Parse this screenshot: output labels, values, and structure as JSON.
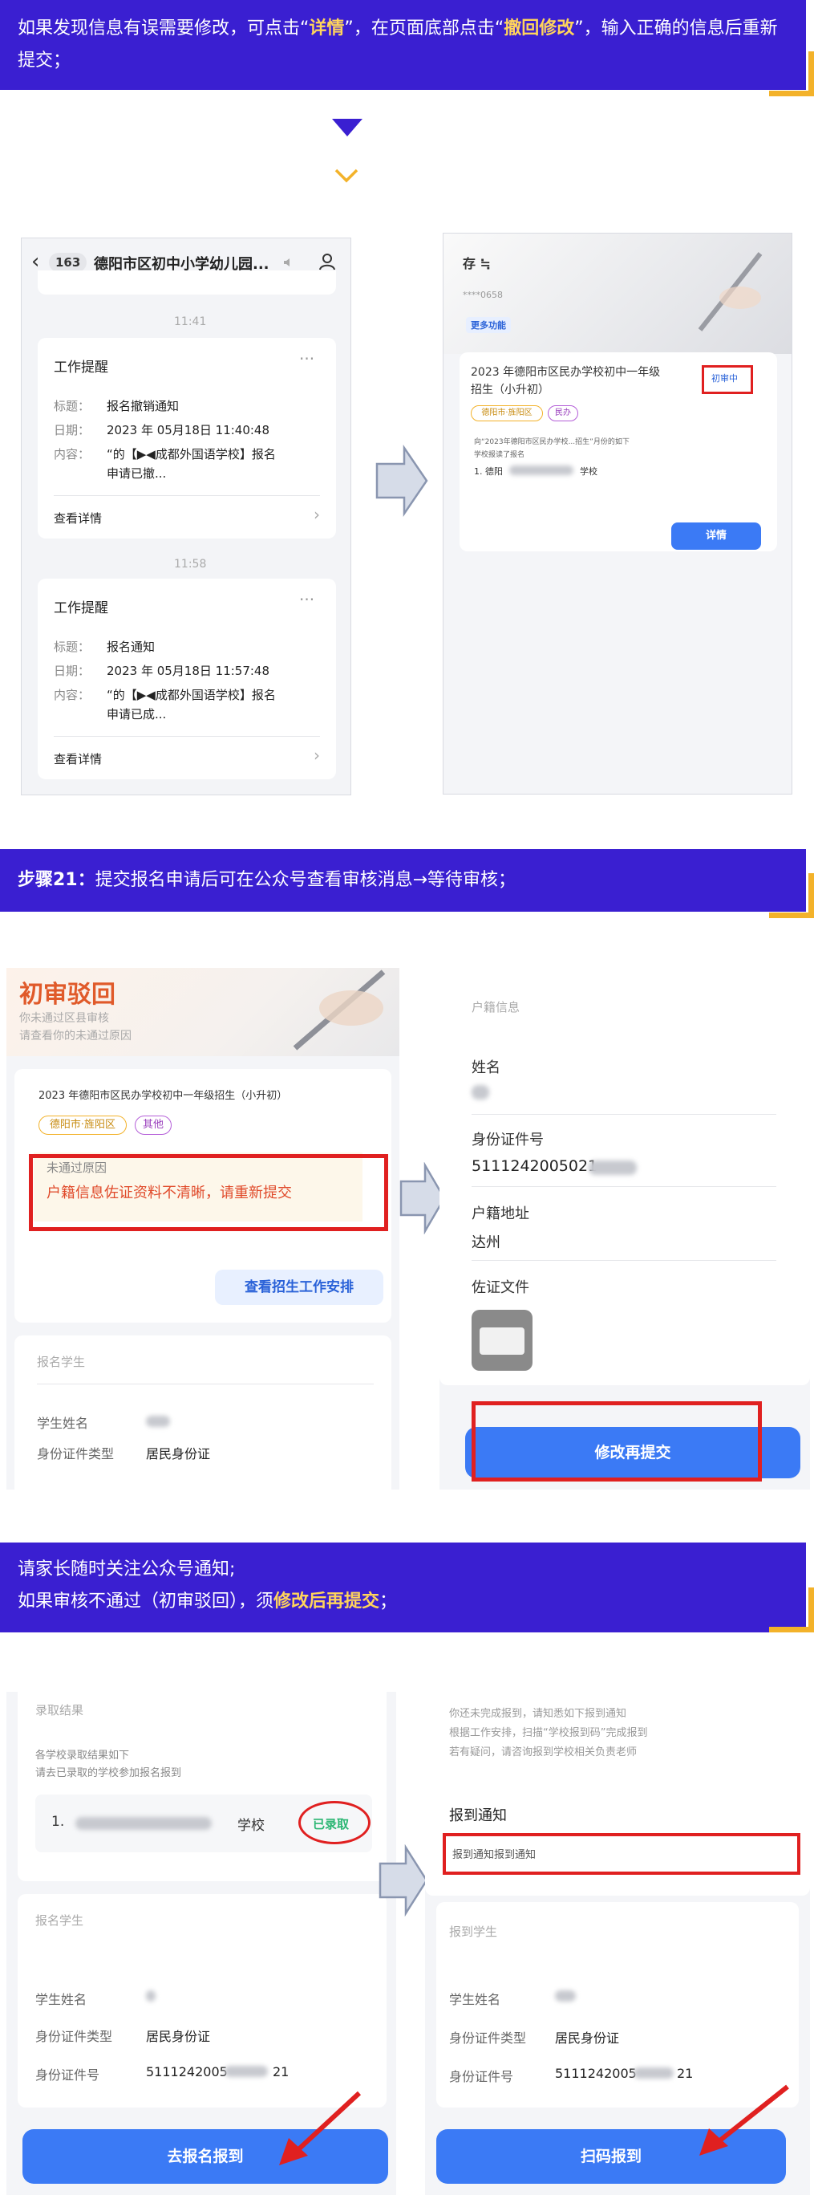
{
  "banner1": {
    "pre": "如果发现信息有误需要修改，可点击“",
    "detail": "详情",
    "mid": "”，在页面底部点击“",
    "withdraw": "撤回修改",
    "post": "”，输入正确的信息后重新提交；"
  },
  "banner2": {
    "step": "步骤21：",
    "text": "提交报名申请后可在公众号查看审核消息→等待审核；"
  },
  "banner3": {
    "line1": "请家长随时关注公众号通知;",
    "line2_pre": "如果审核不通过（初审驳回），须",
    "line2_bold": "修改后再提交",
    "line2_post": "；"
  },
  "phone1": {
    "badge": "163",
    "title": "德阳市区初中小学幼儿园...",
    "time1": "11:41",
    "time2": "11:58",
    "card1": {
      "head": "工作提醒",
      "l1": "标题：",
      "v1": "报名撤销通知",
      "l2": "日期：",
      "v2": "2023 年 05月18日 11:40:48",
      "l3": "内容：",
      "v3a": "“的【▶◀成都外国语学校】报名",
      "v3b": "申请已撤...",
      "link": "查看详情"
    },
    "card2": {
      "head": "工作提醒",
      "l1": "标题：",
      "v1": "报名通知",
      "l2": "日期：",
      "v2": "2023 年 05月18日 11:57:48",
      "l3": "内容：",
      "v3a": "“的【▶◀成都外国语学校】报名",
      "v3b": "申请已成...",
      "link": "查看详情"
    }
  },
  "phone2": {
    "top": "存 ≒",
    "masked": "****0658",
    "more": "更多功能",
    "app_title1": "2023 年德阳市区民办学校初中一年级",
    "app_title2": "招生（小升初）",
    "status": "初审中",
    "tag1": "德阳市·旌阳区",
    "tag2": "民办",
    "desc1": "向“2023年德阳市区民办学校...招生”月份的如下",
    "desc2": "学校报读了报名",
    "school": "1. 德阳",
    "school_end": "学校",
    "detail_btn": "详情"
  },
  "shot3": {
    "head": "初审驳回",
    "sub1": "你未通过区县审核",
    "sub2": "请查看你的未通过原因",
    "app_title": "2023 年德阳市区民办学校初中一年级招生（小升初）",
    "tag1": "德阳市·旌阳区",
    "tag2": "其他",
    "reason_label": "未通过原因",
    "reason": "户籍信息佐证资料不清晰，请重新提交",
    "arrange_btn": "查看招生工作安排",
    "student_head": "报名学生",
    "name_label": "学生姓名",
    "id_type_label": "身份证件类型",
    "id_type": "居民身份证"
  },
  "shot4": {
    "section": "户籍信息",
    "name_label": "姓名",
    "id_label": "身份证件号",
    "id_value": "5111242005021",
    "addr_label": "户籍地址",
    "addr_value": "达州",
    "proof_label": "佐证文件",
    "resubmit_btn": "修改再提交"
  },
  "shot5": {
    "head": "录取结果",
    "desc1": "各学校录取结果如下",
    "desc2": "请去已录取的学校参加报名报到",
    "school_prefix": "1.",
    "school_suffix": "学校",
    "admitted": "已录取",
    "student_head": "报名学生",
    "name_label": "学生姓名",
    "id_type_label": "身份证件类型",
    "id_type": "居民身份证",
    "id_label": "身份证件号",
    "id_value_a": "5111242005",
    "id_value_b": "21",
    "report_btn": "去报名报到"
  },
  "shot6": {
    "desc1": "你还未完成报到，请知悉如下报到通知",
    "desc2": "根据工作安排，扫描“学校报到码”完成报到",
    "desc3": "若有疑问，请咨询报到学校相关负责老师",
    "notice_head": "报到通知",
    "notice_text": "报到通知报到通知",
    "student_head": "报到学生",
    "name_label": "学生姓名",
    "id_type_label": "身份证件类型",
    "id_type": "居民身份证",
    "id_label": "身份证件号",
    "id_value_a": "5111242005",
    "id_value_b": "21",
    "scan_btn": "扫码报到"
  },
  "colors": {
    "banner": "#3a1fd1",
    "accent_yellow": "#ffd45c",
    "corner": "#f3b22a",
    "button_blue": "#3b7af5",
    "highlight_red": "#e02020",
    "admitted_green": "#2bb673"
  }
}
